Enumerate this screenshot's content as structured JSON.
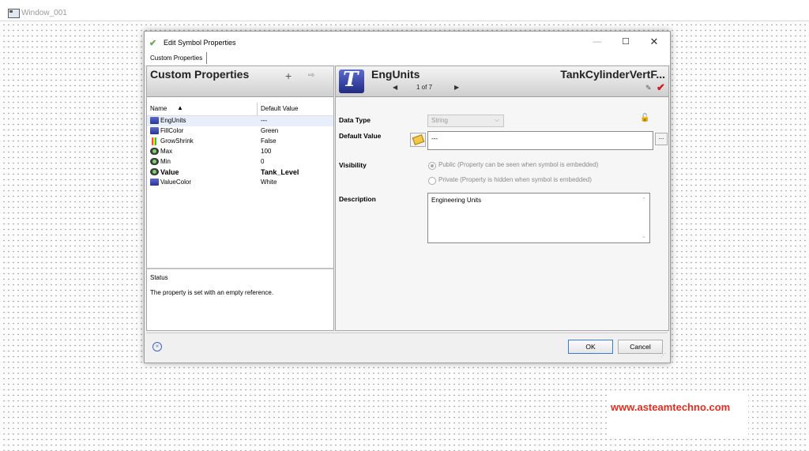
{
  "window": {
    "title": "Window_001"
  },
  "dialog": {
    "title": "Edit Symbol Properties",
    "controls": {
      "minimize": "—",
      "maximize": "☐",
      "close": "✕"
    },
    "tab": "Custom Properties",
    "left_panel": {
      "title": "Custom Properties",
      "add": "+",
      "remove": "⇨",
      "columns": {
        "name": "Name",
        "sort": "▲",
        "default": "Default Value"
      },
      "properties": [
        {
          "name": "EngUnits",
          "value": "---",
          "icon": "text-icon",
          "selected": true
        },
        {
          "name": "FillColor",
          "value": "Green",
          "icon": "text-icon"
        },
        {
          "name": "GrowShrink",
          "value": "False",
          "icon": "color-icon"
        },
        {
          "name": "Max",
          "value": "100",
          "icon": "gauge-icon"
        },
        {
          "name": "Min",
          "value": "0",
          "icon": "gauge-icon"
        },
        {
          "name": "Value",
          "value": "Tank_Level",
          "icon": "gauge-icon",
          "bold": true
        },
        {
          "name": "ValueColor",
          "value": "White",
          "icon": "text-icon"
        }
      ],
      "status_title": "Status",
      "status_text": "The property is set with an empty reference."
    },
    "right_panel": {
      "property_name": "EngUnits",
      "nav_prev": "◀",
      "nav_count": "1 of 7",
      "nav_next": "▶",
      "symbol_name": "TankCylinderVertF...",
      "eraser": "✎",
      "check": "✔",
      "data_type_label": "Data Type",
      "data_type_value": "String",
      "data_type_dropdown": "⌵",
      "lock": "🔓",
      "default_value_label": "Default Value",
      "default_value": "---",
      "browse": "...",
      "visibility_label": "Visibility",
      "public_label": "Public (Property can be seen when symbol is embedded)",
      "private_label": "Private (Property is hidden when symbol is embedded)",
      "description_label": "Description",
      "description": "Engineering Units",
      "scroll_up": "⌃",
      "scroll_down": "⌄"
    },
    "footer": {
      "collapse": "«",
      "ok": "OK",
      "cancel": "Cancel",
      "grip": "⋰"
    }
  },
  "watermark": "www.asteamtechno.com",
  "colors": {
    "accent": "#3a7bd5",
    "check_red": "#d01a1a",
    "watermark_red": "#e82b1e"
  }
}
